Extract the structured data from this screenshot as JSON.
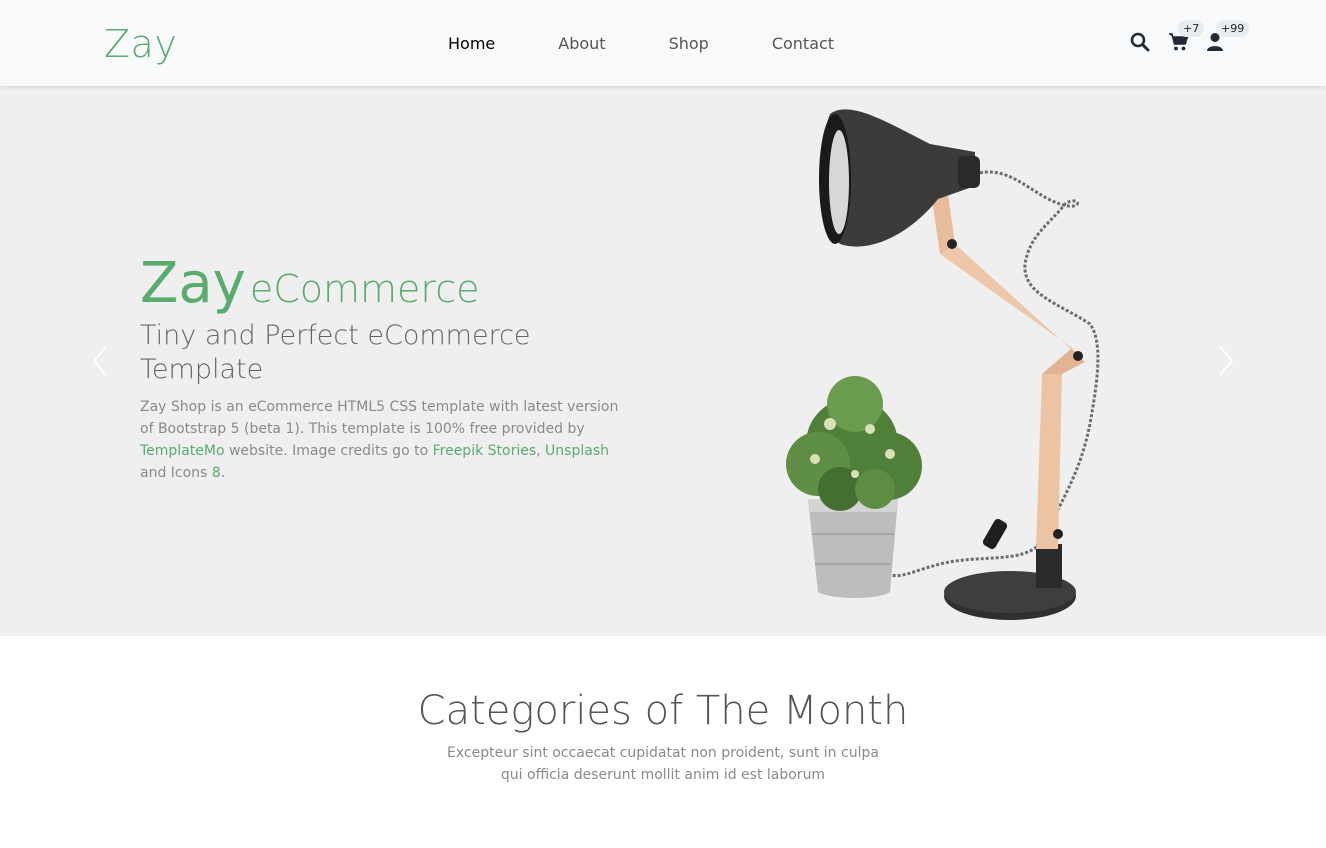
{
  "nav": {
    "logo": "Zay",
    "links": [
      {
        "label": "Home"
      },
      {
        "label": "About"
      },
      {
        "label": "Shop"
      },
      {
        "label": "Contact"
      }
    ],
    "cart_count": "+7",
    "user_count": "+99",
    "icons": [
      "search-icon",
      "cart-icon",
      "user-icon"
    ]
  },
  "hero": {
    "title_brand": "Zay",
    "title_rest": "eCommerce",
    "subtitle": "Tiny and Perfect eCommerce Template",
    "text_1": "Zay Shop is an eCommerce HTML5 CSS template with latest version of Bootstrap 5 (beta 1). This template is 100% free provided by ",
    "link_templatemo": "TemplateMo",
    "text_2": " website. Image credits go to ",
    "link_freepik": "Freepik Stories",
    "text_3": ", ",
    "link_unsplash": "Unsplash",
    "text_4": " and Icons ",
    "link_icons8": "8",
    "text_5": "."
  },
  "categories": {
    "title": "Categories of The Month",
    "text": "Excepteur sint occaecat cupidatat non proident, sunt in culpa qui officia deserunt mollit anim id est laborum"
  },
  "colors": {
    "brand": "#59ab6e",
    "hero_bg": "#efefef",
    "navbar_bg": "#f8f9fa"
  }
}
